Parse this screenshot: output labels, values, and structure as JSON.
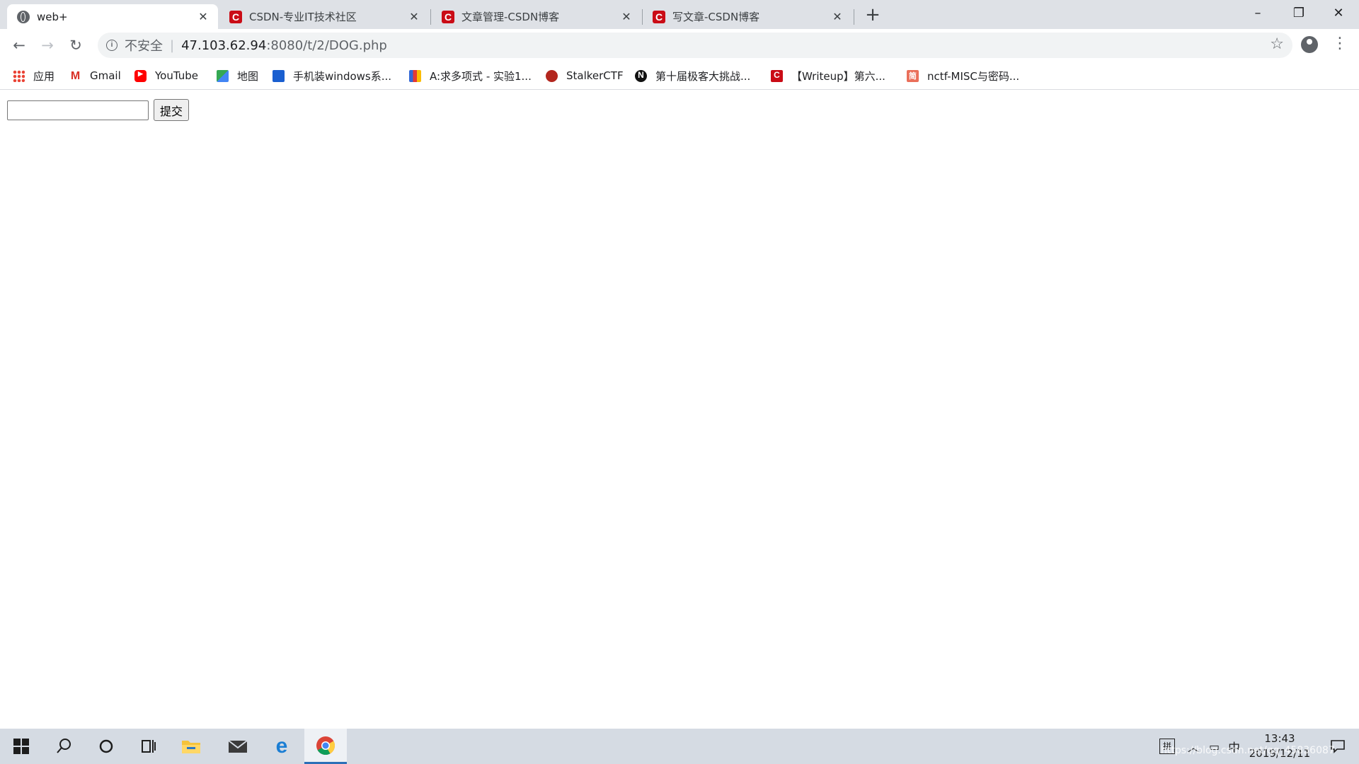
{
  "tabs": [
    {
      "title": "web+",
      "icon": "globe-icon",
      "active": true
    },
    {
      "title": "CSDN-专业IT技术社区",
      "icon": "csdn-icon",
      "active": false
    },
    {
      "title": "文章管理-CSDN博客",
      "icon": "csdn-icon",
      "active": false
    },
    {
      "title": "写文章-CSDN博客",
      "icon": "csdn-icon",
      "active": false
    }
  ],
  "toolbar": {
    "security_label": "不安全",
    "url_host": "47.103.62.94",
    "url_rest": ":8080/t/2/DOG.php"
  },
  "bookmarks": [
    {
      "label": "应用",
      "icon": "apps-grid-icon"
    },
    {
      "label": "Gmail",
      "icon": "gmail-icon"
    },
    {
      "label": "YouTube",
      "icon": "youtube-icon"
    },
    {
      "label": "地图",
      "icon": "maps-icon"
    },
    {
      "label": "手机装windows系...",
      "icon": "bookmark-icon"
    },
    {
      "label": "A:求多项式 - 实验1...",
      "icon": "bookmark-icon"
    },
    {
      "label": "StalkerCTF",
      "icon": "bookmark-icon"
    },
    {
      "label": "第十届极客大挑战...",
      "icon": "notion-icon"
    },
    {
      "label": "【Writeup】第六...",
      "icon": "csdn-icon"
    },
    {
      "label": "nctf-MISC与密码...",
      "icon": "jianshu-icon"
    }
  ],
  "page": {
    "input_value": "",
    "submit_label": "提交"
  },
  "taskbar": {
    "ime_label": "拼",
    "lang_label": "中",
    "time": "13:43",
    "date": "2019/12/11"
  },
  "watermark": "https://blog.csdn.net/qq_45836087"
}
